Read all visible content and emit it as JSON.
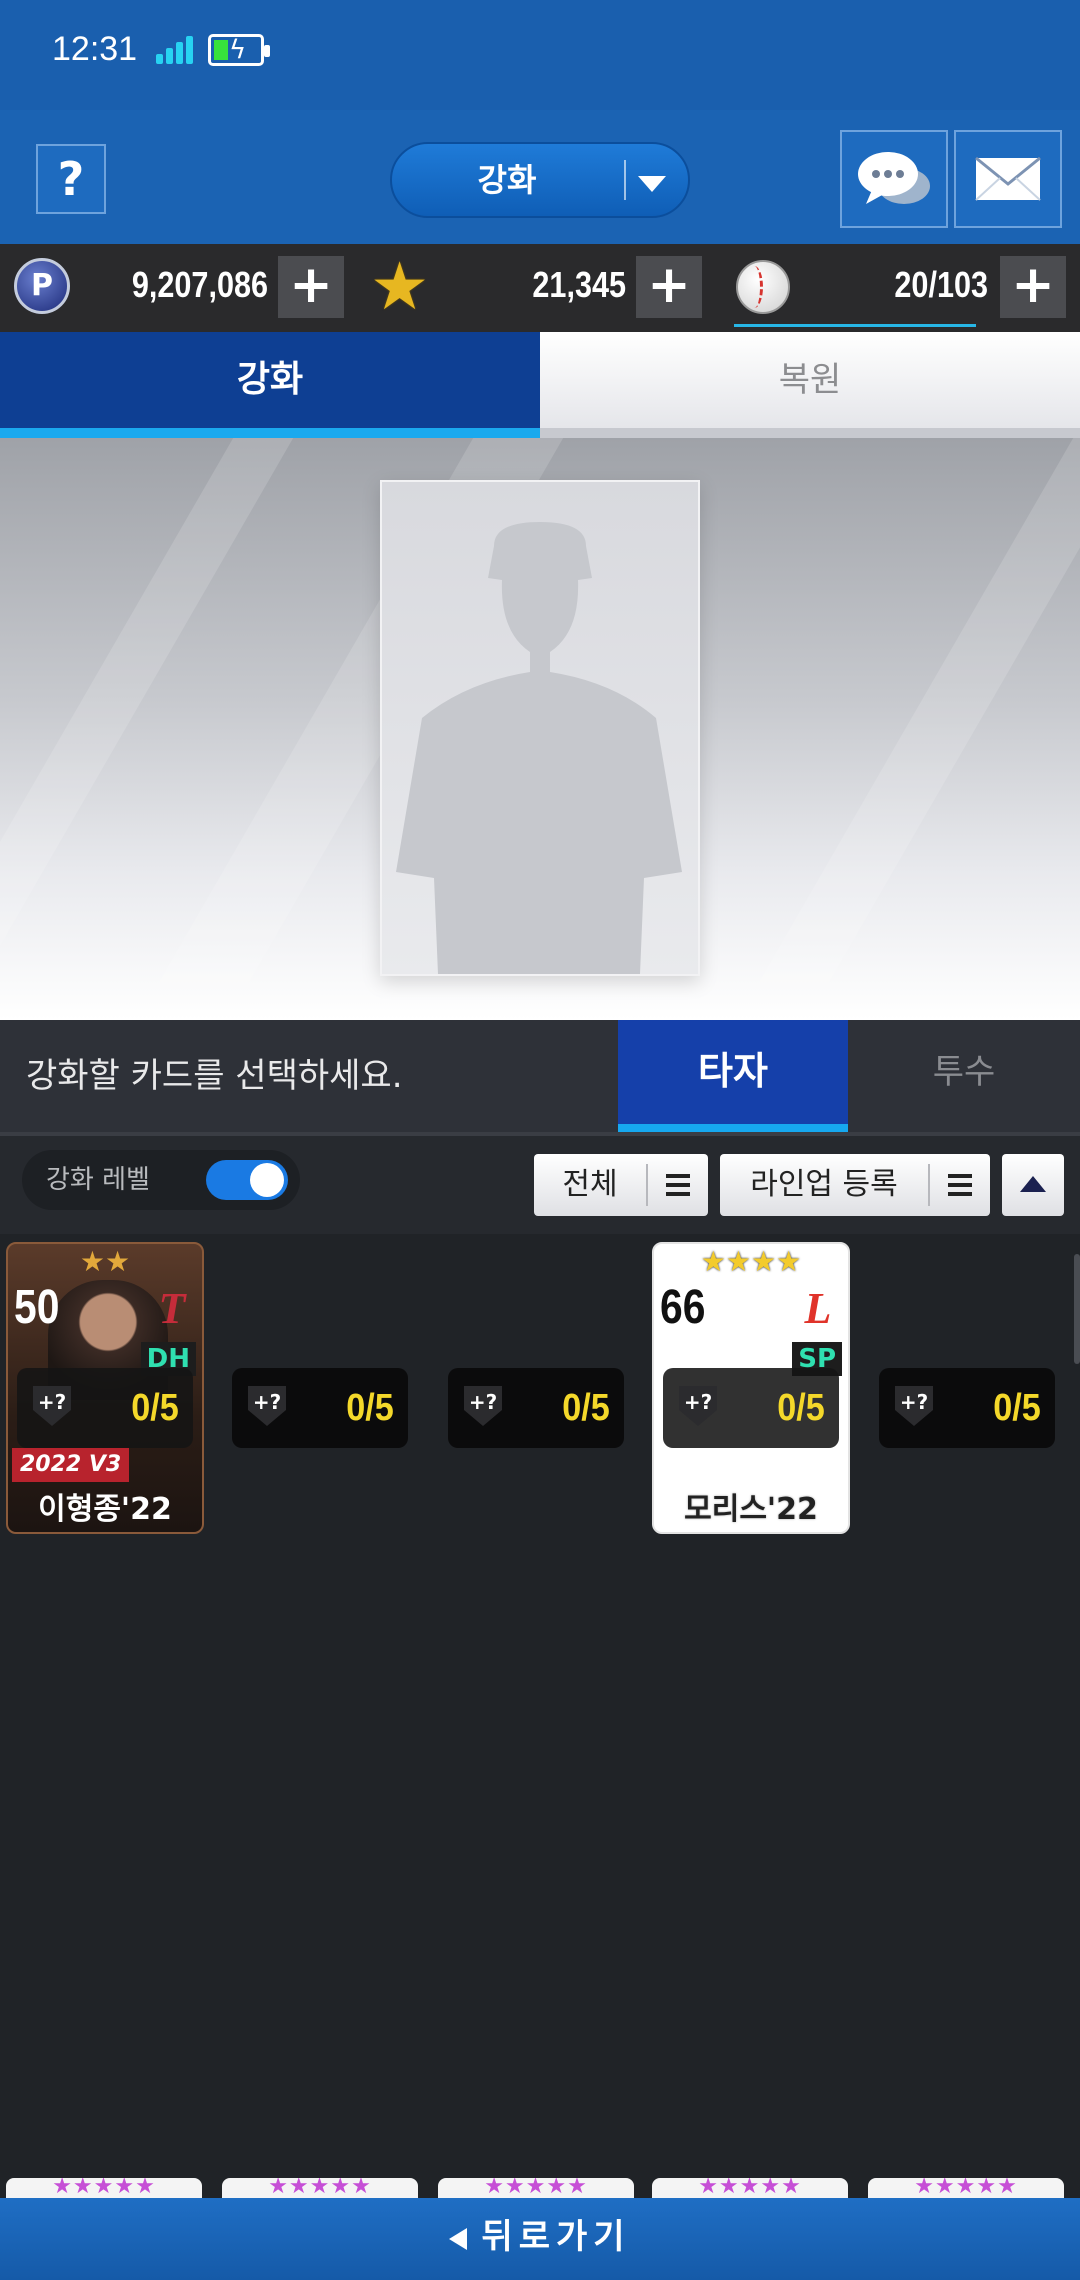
{
  "status_bar": {
    "time": "12:31"
  },
  "header": {
    "help_label": "?",
    "mode_dropdown": {
      "selected": "강화"
    },
    "icons": {
      "chat": "chat-bubbles-icon",
      "mail": "envelope-icon"
    }
  },
  "currency": {
    "points": "9,207,086",
    "stars": "21,345",
    "balls": "20/103",
    "plus": "+",
    "coin_letter": "P"
  },
  "main_tabs": {
    "enhance": "강화",
    "restore": "복원",
    "active": "enhance"
  },
  "selector": {
    "prompt": "강화할 카드를 선택하세요.",
    "batter": "타자",
    "pitcher": "투수",
    "active": "batter"
  },
  "filters": {
    "level_label": "강화 레벨",
    "level_toggle": true,
    "all": "전체",
    "lineup": "라인업 등록"
  },
  "cards": [
    {
      "name": "이형종'22",
      "ovr": "50",
      "stars": "★★",
      "position": "DH",
      "version": "2022 V3",
      "team_mark": "T"
    },
    {
      "name": "모리스'22",
      "ovr": "66",
      "stars": "★★★★",
      "position": "SP",
      "team_mark": "L"
    }
  ],
  "slots": [
    {
      "plate": "+?",
      "count": "0/5"
    },
    {
      "plate": "+?",
      "count": "0/5"
    },
    {
      "plate": "+?",
      "count": "0/5"
    },
    {
      "plate": "+?",
      "count": "0/5"
    },
    {
      "plate": "+?",
      "count": "0/5"
    }
  ],
  "next_row_stars": "★★★★★",
  "footer": {
    "back": "뒤로가기"
  },
  "colors": {
    "header_blue": "#1b63b3",
    "active_tab": "#0e3f93",
    "tab_underline": "#1aa9ee",
    "count_yellow": "#f4d82a",
    "position_green": "#2fe0b0"
  }
}
